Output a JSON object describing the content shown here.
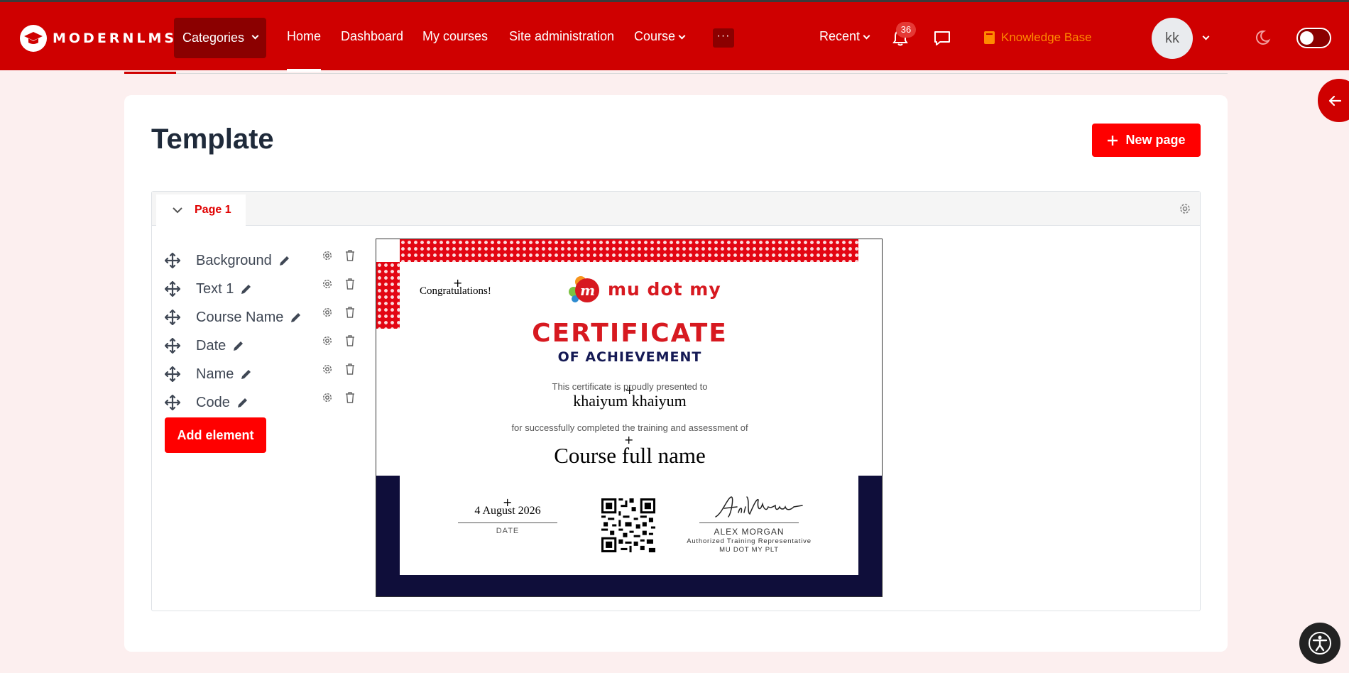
{
  "brand": {
    "name": "MODERNLMS"
  },
  "nav": {
    "categories": "Categories",
    "links": [
      "Home",
      "Dashboard",
      "My courses",
      "Site administration",
      "Course"
    ],
    "more": "···",
    "recent": "Recent",
    "notification_count": "36",
    "knowledge_base": "Knowledge Base",
    "avatar_initials": "kk"
  },
  "page": {
    "title": "Template",
    "new_page_button": "New page"
  },
  "panel": {
    "tab_label": "Page 1",
    "elements": [
      "Background",
      "Text 1",
      "Course Name",
      "Date",
      "Name",
      "Code"
    ],
    "add_element_button": "Add element"
  },
  "certificate": {
    "congrats": "Congratulations!",
    "brand_text": "mu dot my",
    "title": "CERTIFICATE",
    "subtitle": "OF ACHIEVEMENT",
    "presented_to": "This certificate is proudly presented to",
    "recipient": "khaiyum khaiyum",
    "for_text": "for successfully completed the training and assessment of",
    "course": "Course full name",
    "date": "4 August 2026",
    "date_label": "DATE",
    "signer_name": "ALEX MORGAN",
    "signer_role": "Authorized Training Representative",
    "signer_org": "MU DOT MY PLT"
  },
  "colors": {
    "navbar": "#cf0000",
    "accent": "#ff0000",
    "cert_red": "#d71920",
    "cert_navy": "#0f0e3a",
    "knowledge_base": "#ff8a00"
  }
}
